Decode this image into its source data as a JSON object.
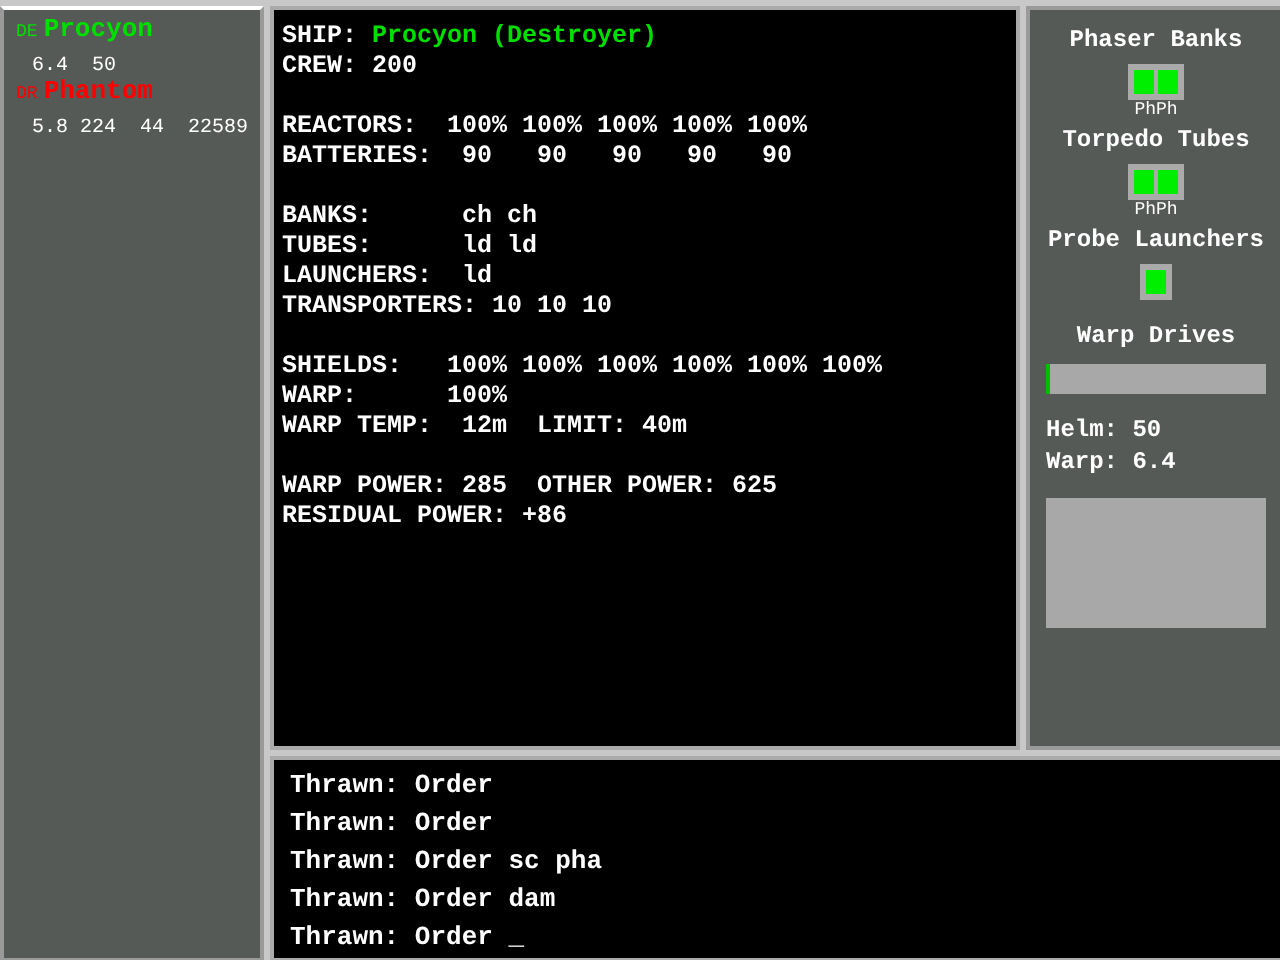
{
  "ships": [
    {
      "code": "DE",
      "name": "Procyon",
      "stats": "6.4  50",
      "color": "#00e000"
    },
    {
      "code": "DR",
      "name": "Phantom",
      "stats": "5.8 224  44  22589",
      "color": "#ff0000"
    }
  ],
  "status": {
    "sections": [
      [
        {
          "label": "SHIP:",
          "value": "Procyon (Destroyer)",
          "highlight": true
        },
        {
          "label": "CREW:",
          "value": "200",
          "highlight": false
        }
      ],
      [
        {
          "label": "REACTORS:",
          "value": "100% 100% 100% 100% 100%",
          "highlight": false
        },
        {
          "label": "BATTERIES:",
          "value": " 90   90   90   90   90",
          "highlight": false
        }
      ],
      [
        {
          "label": "BANKS:",
          "value": "ch ch",
          "highlight": false
        },
        {
          "label": "TUBES:",
          "value": "ld ld",
          "highlight": false
        },
        {
          "label": "LAUNCHERS:",
          "value": "ld",
          "highlight": false
        },
        {
          "label": "TRANSPORTERS:",
          "value": "10 10 10",
          "highlight": false
        }
      ],
      [
        {
          "label": "SHIELDS:",
          "value": "100% 100% 100% 100% 100% 100%",
          "highlight": false
        },
        {
          "label": "WARP:",
          "value": "100%",
          "highlight": false
        },
        {
          "label": "WARP TEMP:",
          "value": " 12m  LIMIT: 40m",
          "highlight": false
        }
      ],
      [
        {
          "label": "WARP POWER:",
          "value": "285  OTHER POWER: 625",
          "highlight": false
        },
        {
          "label": "RESIDUAL POWER:",
          "value": "+86",
          "highlight": false
        }
      ]
    ]
  },
  "systems": [
    {
      "kind": "slots",
      "title": "Phaser Banks",
      "slots": [
        {
          "on": true
        },
        {
          "on": true
        }
      ],
      "caption": "PhPh"
    },
    {
      "kind": "slots",
      "title": "Torpedo Tubes",
      "slots": [
        {
          "on": true
        },
        {
          "on": true
        }
      ],
      "caption": "PhPh"
    },
    {
      "kind": "slots",
      "title": "Probe Launchers",
      "slots": [
        {
          "on": true
        }
      ]
    },
    {
      "kind": "bar",
      "title": "Warp Drives",
      "level": 0.02
    }
  ],
  "readouts": [
    {
      "label": "Helm:",
      "value": "50"
    },
    {
      "label": "Warp:",
      "value": "6.4"
    }
  ],
  "console": [
    "Thrawn: Order",
    "Thrawn: Order",
    "Thrawn: Order sc pha",
    "Thrawn: Order dam",
    "Thrawn: Order _"
  ]
}
